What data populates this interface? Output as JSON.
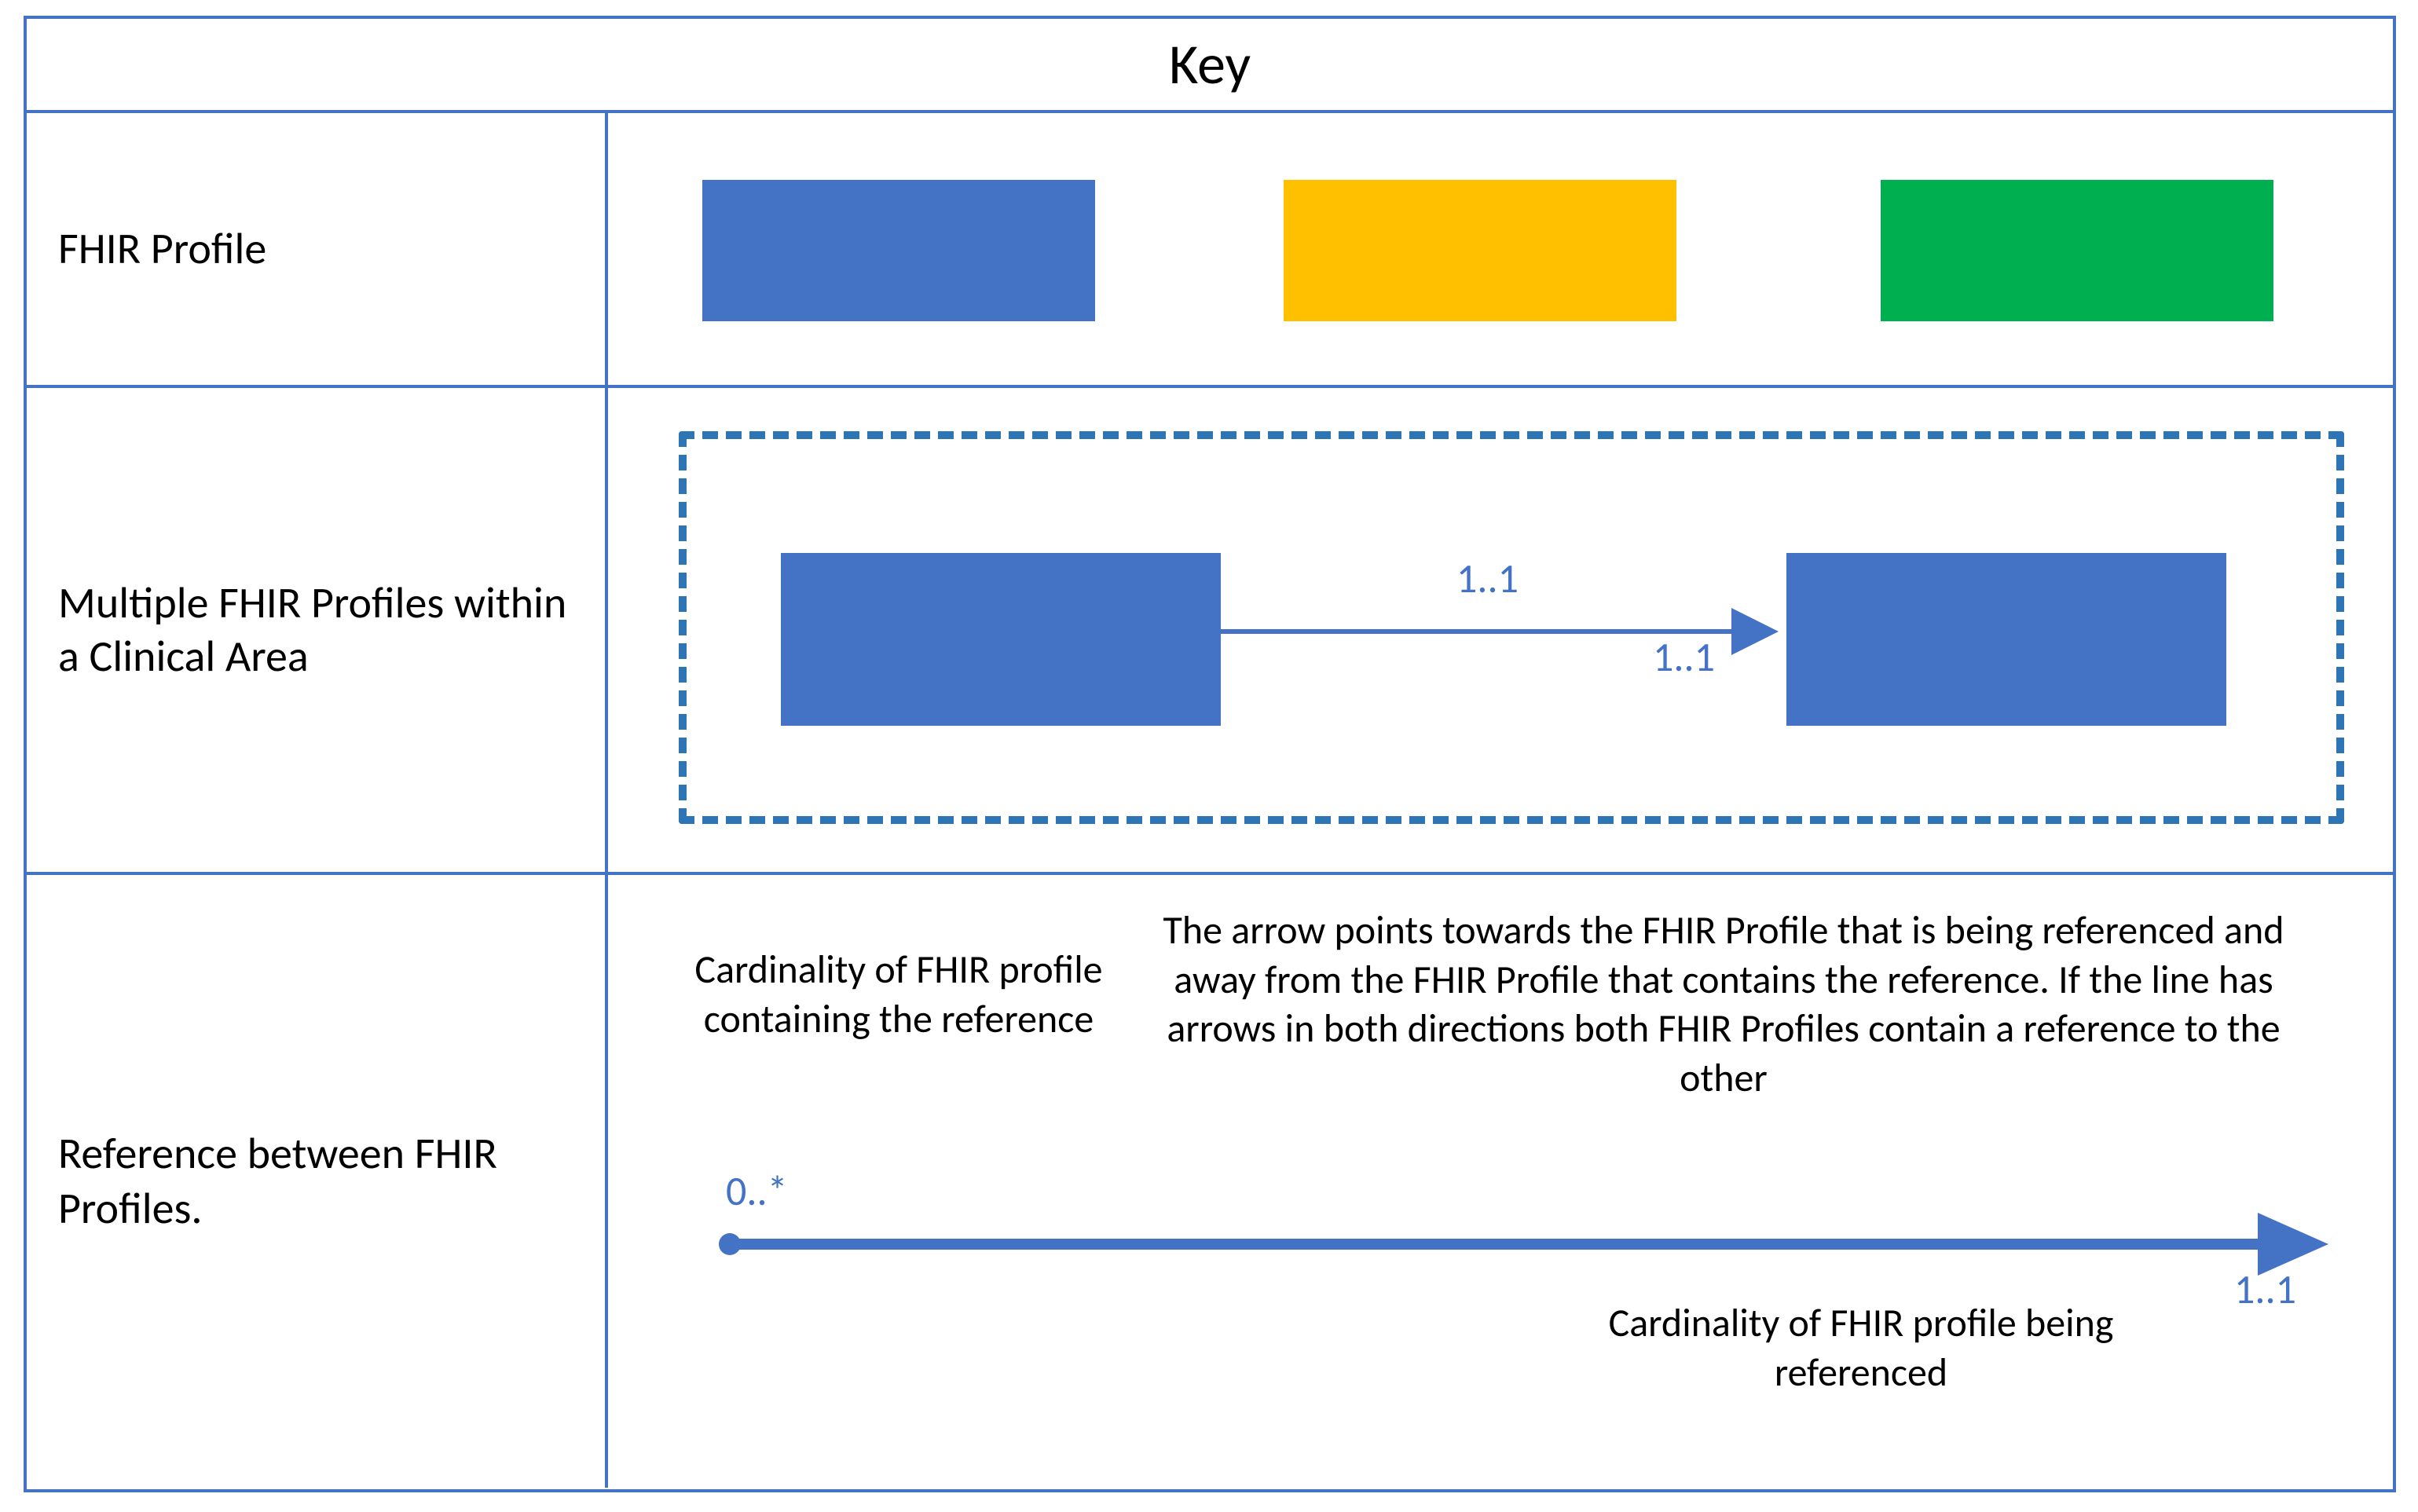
{
  "title": "Key",
  "row1": {
    "label": "FHIR Profile",
    "colors": {
      "blue": "#4472c4",
      "yellow": "#ffc000",
      "green": "#00b050"
    }
  },
  "row2": {
    "label": "Multiple FHIR Profiles within a Clinical Area",
    "cardinality_source": "1..1",
    "cardinality_target": "1..1"
  },
  "row3": {
    "label": "Reference between FHIR Profiles.",
    "text_cardinality_containing": "Cardinality of FHIR profile containing the reference",
    "text_arrow_description": "The arrow points towards the FHIR Profile that is being referenced and away from the FHIR Profile that contains the reference. If the line has arrows in both directions both FHIR Profiles contain a reference to the other",
    "text_cardinality_referenced": "Cardinality of FHIR profile being referenced",
    "cardinality_source": "0..*",
    "cardinality_target": "1..1"
  }
}
